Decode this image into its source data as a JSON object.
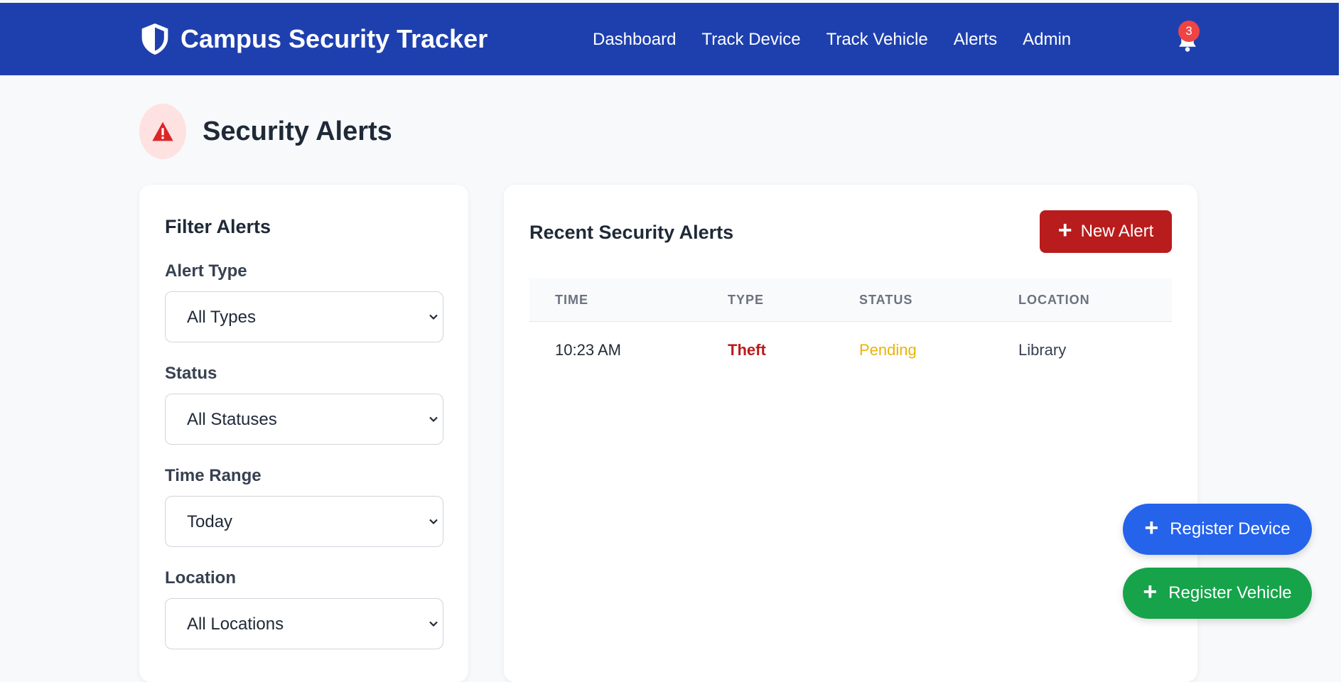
{
  "header": {
    "brand": "Campus Security Tracker",
    "nav": [
      "Dashboard",
      "Track Device",
      "Track Vehicle",
      "Alerts",
      "Admin"
    ],
    "notification_count": "3"
  },
  "page": {
    "title": "Security Alerts"
  },
  "filters": {
    "title": "Filter Alerts",
    "fields": [
      {
        "label": "Alert Type",
        "value": "All Types"
      },
      {
        "label": "Status",
        "value": "All Statuses"
      },
      {
        "label": "Time Range",
        "value": "Today"
      },
      {
        "label": "Location",
        "value": "All Locations"
      }
    ]
  },
  "alerts": {
    "title": "Recent Security Alerts",
    "new_button": "New Alert",
    "columns": [
      "TIME",
      "TYPE",
      "STATUS",
      "LOCATION"
    ],
    "rows": [
      {
        "time": "10:23 AM",
        "type": "Theft",
        "status": "Pending",
        "location": "Library"
      }
    ]
  },
  "fab": {
    "device": "Register Device",
    "vehicle": "Register Vehicle"
  },
  "colors": {
    "nav": "#1e40af",
    "danger": "#b91c1c",
    "pending": "#eab308",
    "primary": "#2563eb",
    "success": "#16a34a"
  }
}
